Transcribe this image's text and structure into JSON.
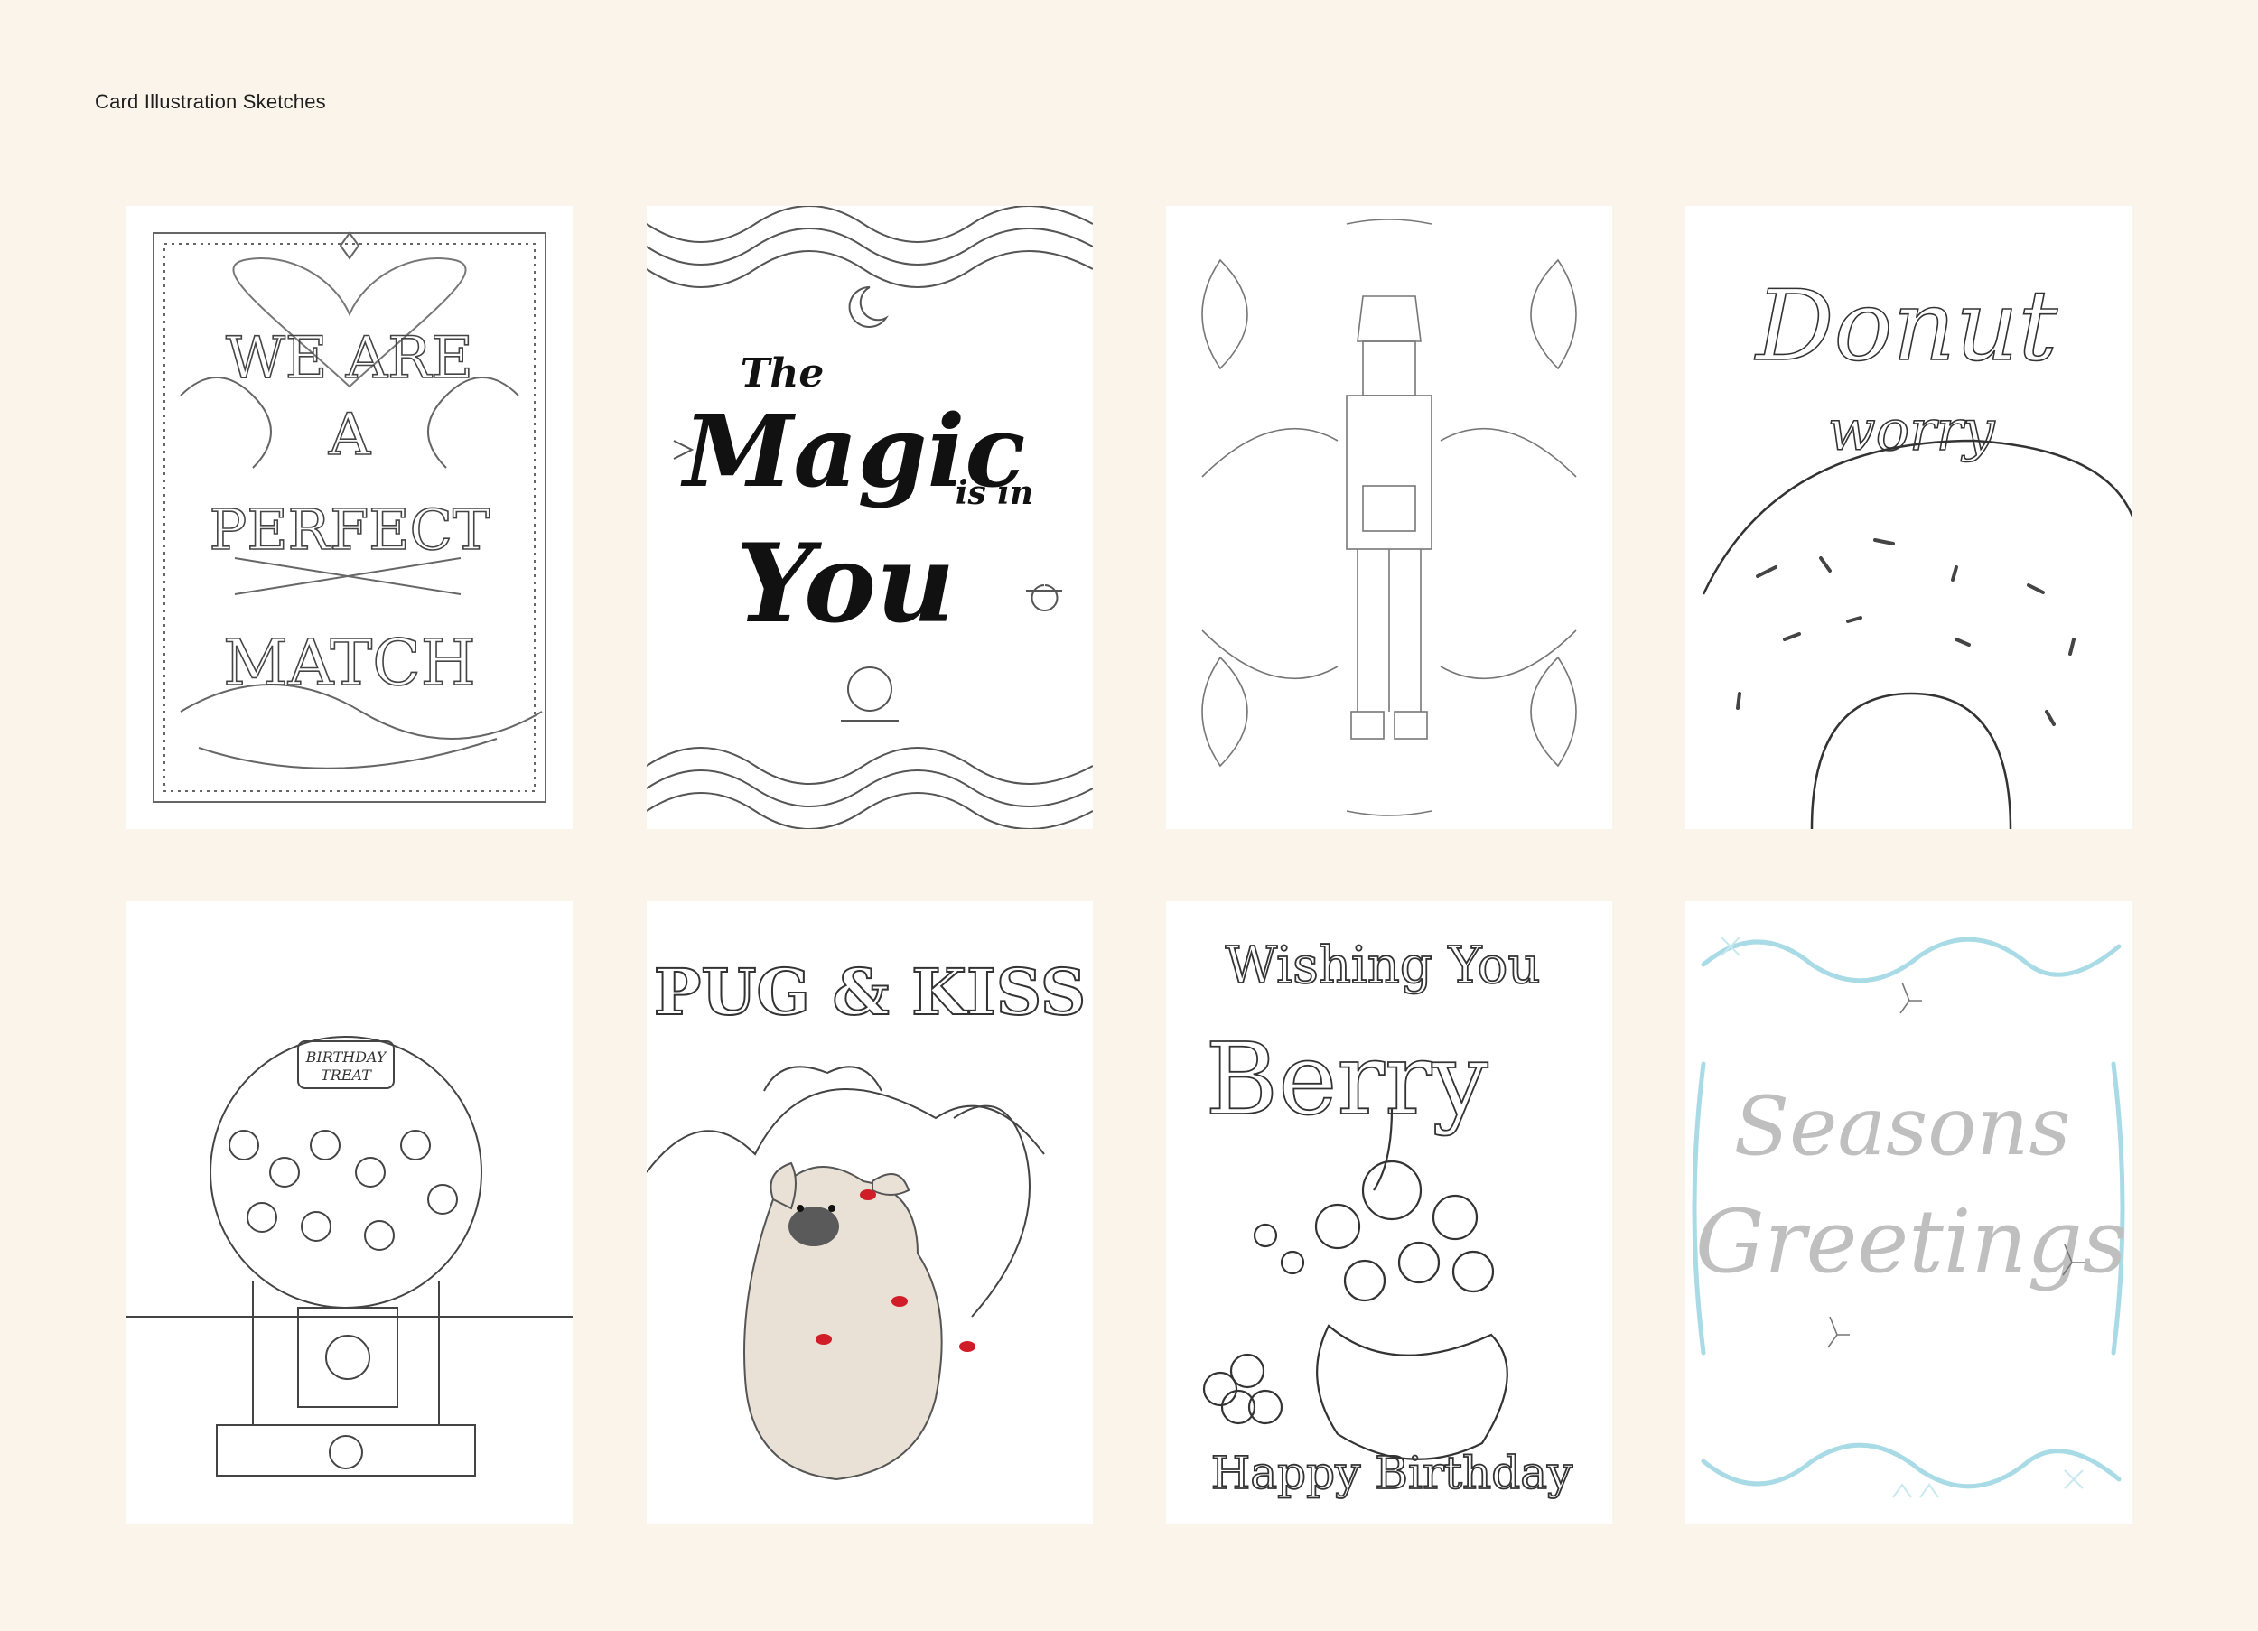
{
  "page": {
    "title": "Card Illustration Sketches"
  },
  "cards": [
    {
      "lines": [
        "WE ARE",
        "A",
        "PERFECT",
        "MATCH"
      ]
    },
    {
      "lines": [
        "The",
        "Magic",
        "is in",
        "You"
      ]
    },
    {
      "lines": []
    },
    {
      "lines": [
        "Donut",
        "worry"
      ]
    },
    {
      "lines": [
        "BIRTHDAY",
        "TREAT"
      ]
    },
    {
      "lines": [
        "PUG & KISS"
      ]
    },
    {
      "lines": [
        "Wishing You",
        "Berry",
        "Happy Birthday"
      ]
    },
    {
      "lines": [
        "Seasons",
        "Greetings"
      ]
    }
  ]
}
